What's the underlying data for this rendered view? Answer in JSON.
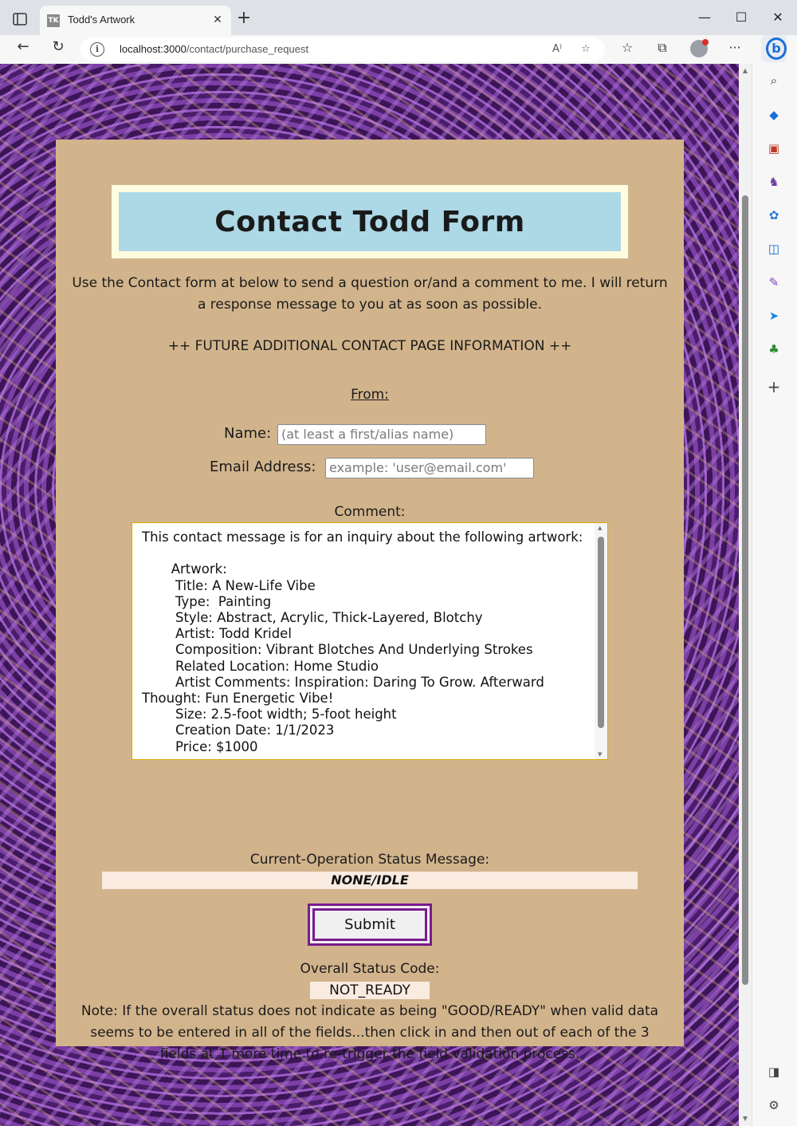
{
  "browser": {
    "tab_title": "Todd's Artwork",
    "tab_favicon_text": "TK",
    "url_host": "localhost:3000",
    "url_path": "/contact/purchase_request"
  },
  "page": {
    "title": "Contact Todd Form",
    "intro": "Use the Contact form at below to send a question or/and a comment to me. I will return a response message to you at as soon as possible.",
    "future_info": "++ FUTURE ADDITIONAL CONTACT PAGE INFORMATION ++",
    "from_label": "From:",
    "name_label": "Name:",
    "name_placeholder": "(at least a first/alias name)",
    "email_label": "Email Address:",
    "email_placeholder": "example: 'user@email.com'",
    "comment_label": "Comment:",
    "comment_text": "This contact message is for an inquiry about the following artwork:\n\n       Artwork:\n        Title: A New-Life Vibe\n        Type:  Painting\n        Style: Abstract, Acrylic, Thick-Layered, Blotchy\n        Artist: Todd Kridel\n        Composition: Vibrant Blotches And Underlying Strokes\n        Related Location: Home Studio\n        Artist Comments: Inspiration: Daring To Grow. Afterward Thought: Fun Energetic Vibe!\n        Size: 2.5-foot width; 5-foot height\n        Creation Date: 1/1/2023\n        Price: $1000",
    "status_message_label": "Current-Operation Status Message:",
    "status_message_value": "NONE/IDLE",
    "submit_label": "Submit",
    "overall_status_label": "Overall Status Code:",
    "overall_status_value": "NOT_READY",
    "note": "Note: If the overall status does not indicate as being \"GOOD/READY\" when valid data seems to be entered in all of the fields...then click in and then out of each of the 3 fields at 1 more time to re-trigger the field validation process."
  },
  "icons": {
    "tab_strip": "tab-actions-icon",
    "close_tab": "close-icon",
    "new_tab": "plus-icon",
    "back": "back-arrow-icon",
    "refresh": "refresh-icon",
    "site_info": "info-icon",
    "read_aloud": "read-aloud-icon",
    "add_favorite": "add-favorite-icon",
    "favorites": "favorites-icon",
    "collections": "collections-icon",
    "more": "ellipsis-icon",
    "bing": "bing-copilot-icon"
  }
}
